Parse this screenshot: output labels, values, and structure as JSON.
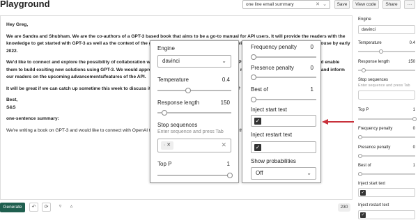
{
  "header": {
    "title": "Playground",
    "preset_value": "one line email summary",
    "save_label": "Save",
    "view_code_label": "View code",
    "share_label": "Share",
    "more_label": "···"
  },
  "editor": {
    "greeting": "Hey Greg,",
    "para1": "We are Sandra and Shubham. We are the co-authors of a GPT-3 based book that aims to be a go-to manual for API users. It will provide the readers with the knowledge to get started with GPT-3 as well as the context of the growing ecosystem around it. The book will be released by a tech publishing house by early 2022.",
    "para2": "We'd like to connect and explore the possibility of collaboration with OpenAI to evangelize access to the API for people from all backgrounds and enable them to build exciting new solutions using GPT-3. We would appreciate your input to ensure we accurately represent OpenAI's stance on GPT-3 and inform our readers on the upcoming advancements/features of the API.",
    "para3": "It will be great if we can catch up sometime this week to discuss it further and explore ways to collaborate?",
    "signoff": "Best,",
    "signature": "S&S",
    "summary_label": "one-sentence summary:",
    "summary": "We're writing a book on GPT-3 and would like to connect with OpenAI to get a better understanding of the API and the future developments."
  },
  "footer": {
    "generate_label": "Generate",
    "counter": "230"
  },
  "sidebar": {
    "engine_label": "Engine",
    "engine_value": "davinci",
    "temperature_label": "Temperature",
    "temperature_value": "0.4",
    "response_label": "Response length",
    "response_value": "150",
    "stop_label": "Stop sequences",
    "stop_placeholder": "Enter sequence and press Tab",
    "topp_label": "Top P",
    "topp_value": "1",
    "freq_label": "Frequency penalty",
    "freq_value": "0",
    "presence_label": "Presence penalty",
    "presence_value": "0",
    "bestof_label": "Best of",
    "bestof_value": "1",
    "inject_start_label": "Inject start text",
    "inject_restart_label": "Inject restart text"
  },
  "zoom_left": {
    "engine_label": "Engine",
    "engine_value": "davinci",
    "temperature_label": "Temperature",
    "temperature_value": "0.4",
    "response_label": "Response length",
    "response_value": "150",
    "stop_label": "Stop sequences",
    "stop_placeholder": "Enter sequence and press Tab",
    "topp_label": "Top P",
    "topp_value": "1"
  },
  "zoom_right": {
    "freq_label": "Frequency penalty",
    "freq_value": "0",
    "presence_label": "Presence penalty",
    "presence_value": "0",
    "bestof_label": "Best of",
    "bestof_value": "1",
    "inject_start_label": "Inject start text",
    "inject_restart_label": "Inject restart text",
    "probs_label": "Show probabilities",
    "probs_value": "Off"
  },
  "colors": {
    "generate_bg": "#1f5f4f",
    "arrow": "#c8313b"
  }
}
